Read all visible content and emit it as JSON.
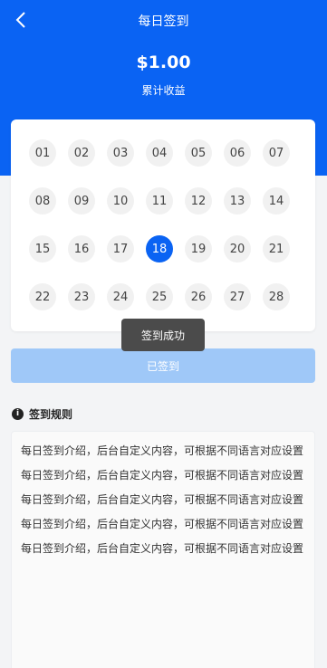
{
  "header": {
    "title": "每日签到",
    "amount": "$1.00",
    "amount_label": "累计收益"
  },
  "calendar": {
    "days": [
      "01",
      "02",
      "03",
      "04",
      "05",
      "06",
      "07",
      "08",
      "09",
      "10",
      "11",
      "12",
      "13",
      "14",
      "15",
      "16",
      "17",
      "18",
      "19",
      "20",
      "21",
      "22",
      "23",
      "24",
      "25",
      "26",
      "27",
      "28"
    ],
    "today": "18",
    "today_color": "#0a63f3"
  },
  "toast": {
    "text": "签到成功"
  },
  "actions": {
    "signed_label": "已签到"
  },
  "rules": {
    "title": "签到规则",
    "lines": [
      "每日签到介绍，后台自定义内容，可根据不同语言对应设置",
      "每日签到介绍，后台自定义内容，可根据不同语言对应设置",
      "每日签到介绍，后台自定义内容，可根据不同语言对应设置",
      "每日签到介绍，后台自定义内容，可根据不同语言对应设置",
      "每日签到介绍，后台自定义内容，可根据不同语言对应设置"
    ]
  },
  "colors": {
    "primary": "#0a63f3",
    "button_disabled": "#9fc8f8",
    "toast_bg": "#4b4b4b"
  }
}
